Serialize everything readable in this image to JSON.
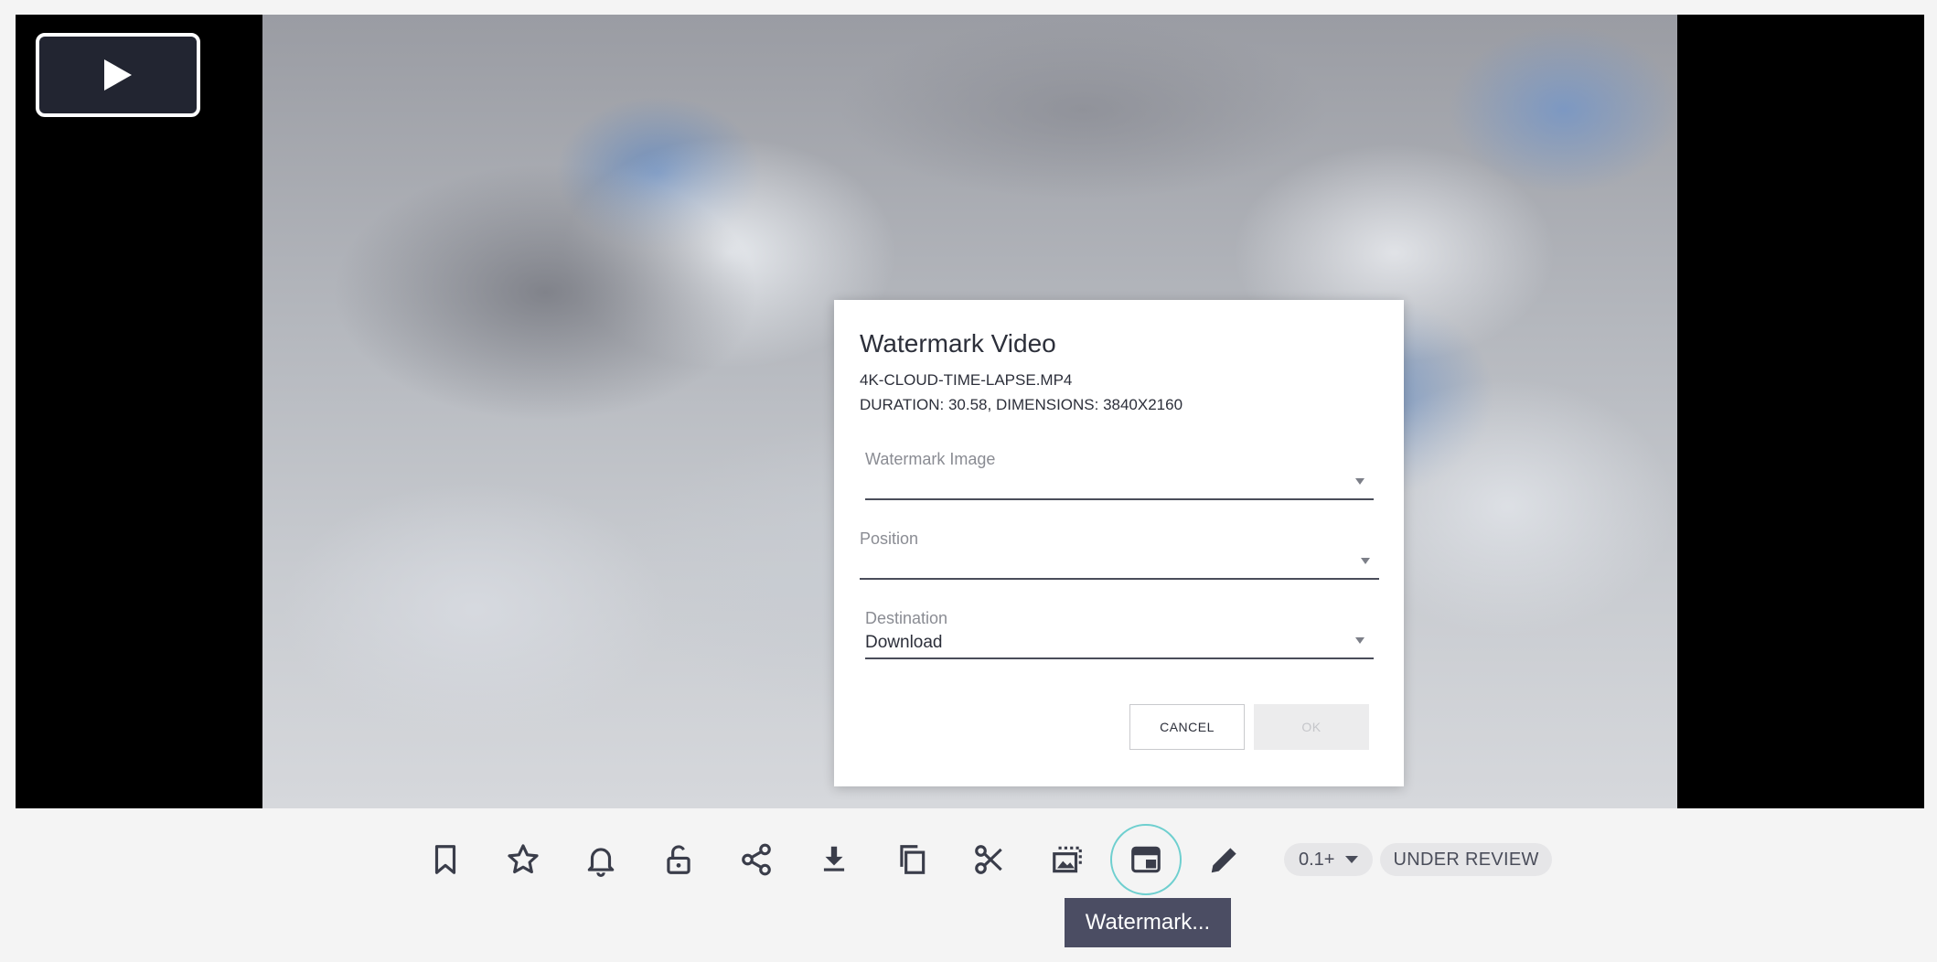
{
  "player": {
    "play_icon": "play-icon"
  },
  "dialog": {
    "title": "Watermark Video",
    "filename": "4K-CLOUD-TIME-LAPSE.MP4",
    "meta": "DURATION: 30.58, DIMENSIONS: 3840X2160",
    "watermark_image": {
      "label": "Watermark Image",
      "value": ""
    },
    "position": {
      "label": "Position",
      "value": ""
    },
    "destination": {
      "label": "Destination",
      "value": "Download"
    },
    "cancel_label": "CANCEL",
    "ok_label": "OK"
  },
  "toolbar": {
    "tools": [
      "bookmark-icon",
      "star-icon",
      "bell-icon",
      "unlock-icon",
      "share-icon",
      "download-icon",
      "copy-icon",
      "scissors-icon",
      "crop-image-icon",
      "watermark-icon",
      "pencil-icon"
    ],
    "version_label": "0.1+",
    "status_label": "UNDER REVIEW",
    "accent_color": "#6ecfcf"
  },
  "tooltip": {
    "text": "Watermark..."
  }
}
